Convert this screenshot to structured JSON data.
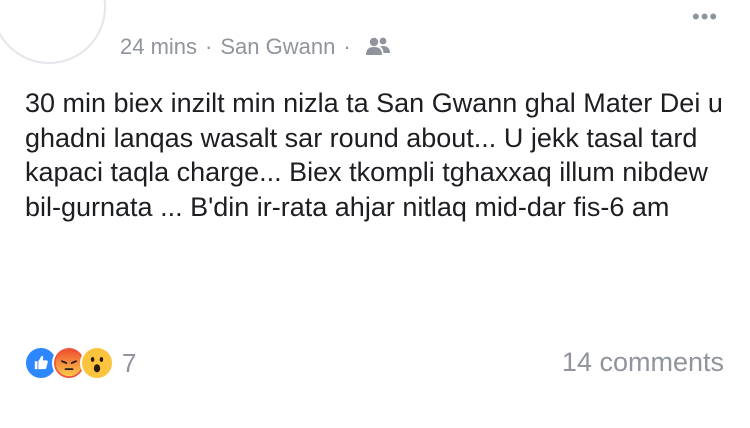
{
  "post": {
    "time": "24 mins",
    "separator": "·",
    "location": "San Gwann",
    "audience_icon": "group-icon",
    "text": "30 min biex inzilt min nizla ta San Gwann ghal Mater Dei u ghadni lanqas wasalt sar round about... U jekk tasal tard kapaci taqla charge... Biex tkompli tghaxxaq illum nibdew bil-gurnata ... B'din ir-rata ahjar nitlaq mid-dar fis-6 am"
  },
  "menu": {
    "icon": "more-options-icon",
    "glyph": "•••"
  },
  "reactions": {
    "icons": [
      "like-icon",
      "angry-icon",
      "wow-icon"
    ],
    "count": "7"
  },
  "comments": {
    "label": "14 comments"
  },
  "colors": {
    "like": "#2d87ff",
    "angry": "#f2553e",
    "wow": "#fcc43e",
    "meta": "#90949c"
  }
}
